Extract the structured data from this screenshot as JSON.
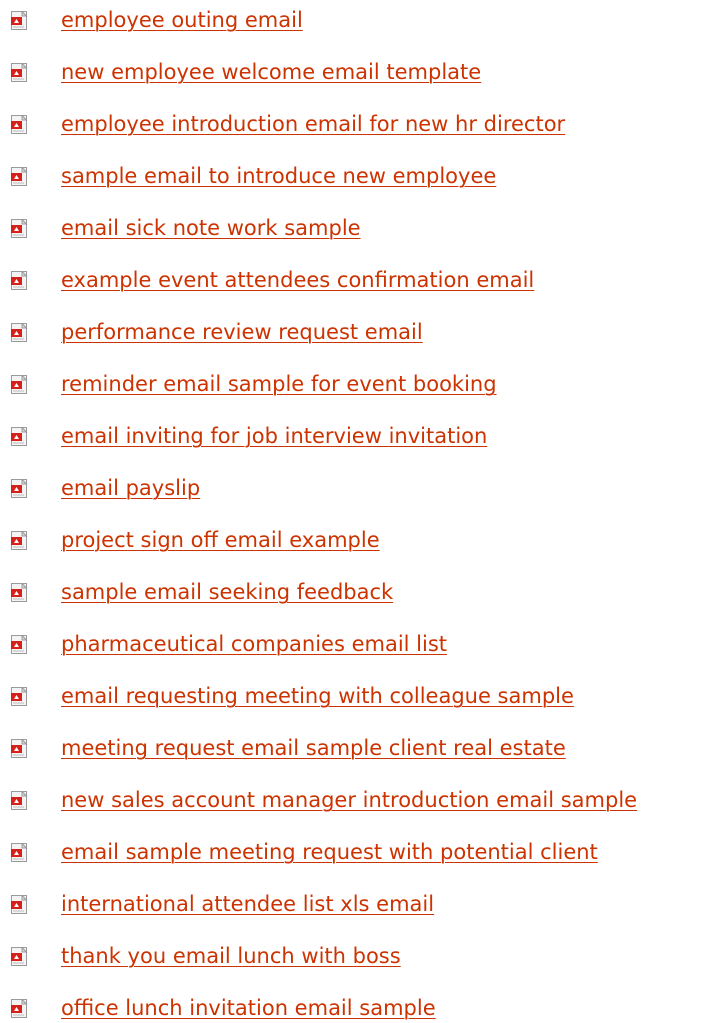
{
  "link_color": "#cc3300",
  "icon": "pdf-document-icon",
  "links": [
    "employee outing email",
    "new employee welcome email template",
    "employee introduction email for new hr director",
    "sample email to introduce new employee",
    "email sick note work sample",
    "example event attendees confirmation email",
    "performance review request email",
    "reminder email sample for event booking",
    "email inviting for job interview invitation",
    "email payslip",
    "project sign off email example",
    "sample email seeking feedback",
    "pharmaceutical companies email list",
    "email requesting meeting with colleague sample",
    "meeting request email sample client real estate",
    "new sales account manager introduction email sample",
    "email sample meeting request with potential client",
    "international attendee list xls email",
    "thank you email lunch with boss",
    "office lunch invitation email sample"
  ]
}
